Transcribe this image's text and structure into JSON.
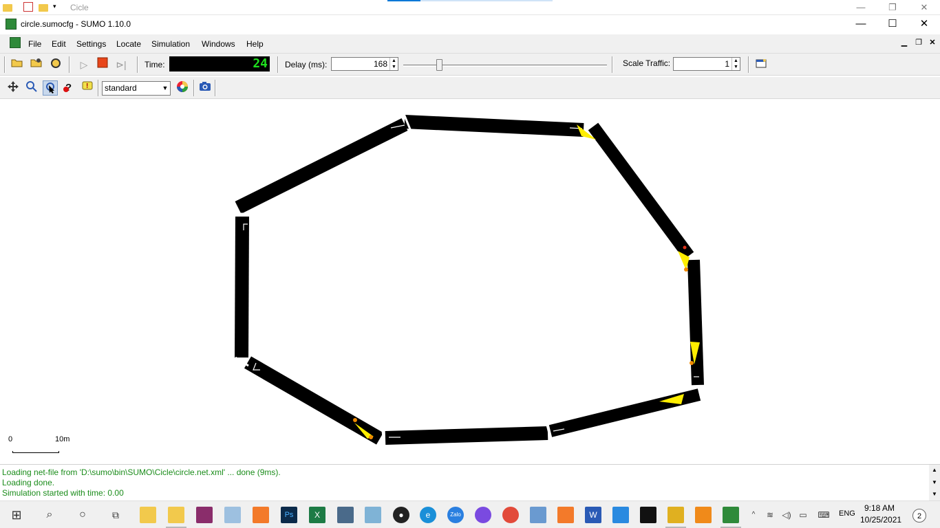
{
  "explorer": {
    "title": "Cicle"
  },
  "window": {
    "title": "circle.sumocfg - SUMO 1.10.0"
  },
  "menu": [
    {
      "label": "File"
    },
    {
      "label": "Edit"
    },
    {
      "label": "Settings"
    },
    {
      "label": "Locate"
    },
    {
      "label": "Simulation"
    },
    {
      "label": "Windows"
    },
    {
      "label": "Help"
    }
  ],
  "toolbar": {
    "time_label": "Time:",
    "time_value": "24",
    "delay_label": "Delay (ms):",
    "delay_value": "168",
    "scale_label": "Scale Traffic:",
    "scale_value": "1"
  },
  "view": {
    "scheme": "standard"
  },
  "scale_bar": {
    "start": "0",
    "end": "10m"
  },
  "log": [
    "Loading net-file from 'D:\\sumo\\bin\\SUMO\\Cicle\\circle.net.xml' ... done (9ms).",
    "Loading done.",
    "Simulation started with time: 0.00"
  ],
  "tray": {
    "lang": "ENG",
    "time": "9:18 AM",
    "date": "10/25/2021",
    "notifications": "2"
  },
  "colors": {
    "road": "#000000",
    "vehicle": "#ffee00",
    "log_text": "#1a8c1a",
    "time_digits": "#1ee01e"
  }
}
